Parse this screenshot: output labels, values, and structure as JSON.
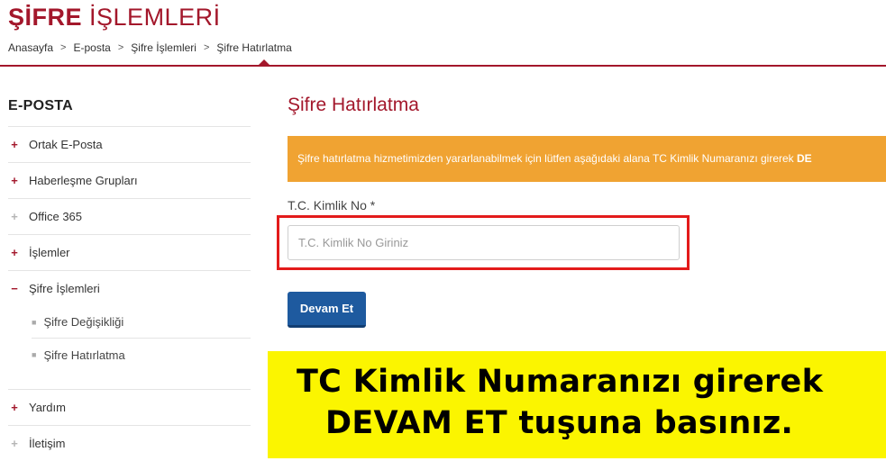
{
  "header": {
    "title_bold": "ŞİFRE",
    "title_light": "İŞLEMLERİ",
    "breadcrumb": [
      "Anasayfa",
      "E-posta",
      "Şifre İşlemleri",
      "Şifre Hatırlatma"
    ],
    "breadcrumb_separator": ">"
  },
  "sidebar": {
    "title": "E-POSTA",
    "items": [
      {
        "label": "Ortak E-Posta",
        "icon": "plus-icon",
        "icon_glyph": "+"
      },
      {
        "label": "Haberleşme Grupları",
        "icon": "plus-icon",
        "icon_glyph": "+"
      },
      {
        "label": "Office 365",
        "icon": "plus-icon",
        "icon_glyph": "+"
      },
      {
        "label": "İşlemler",
        "icon": "plus-icon",
        "icon_glyph": "+"
      },
      {
        "label": "Şifre İşlemleri",
        "icon": "minus-icon",
        "icon_glyph": "−"
      },
      {
        "label": "Yardım",
        "icon": "plus-icon",
        "icon_glyph": "+"
      },
      {
        "label": "İletişim",
        "icon": "plus-icon",
        "icon_glyph": "+"
      }
    ],
    "subitems": [
      {
        "label": "Şifre Değişikliği",
        "bullet": "■"
      },
      {
        "label": "Şifre Hatırlatma",
        "bullet": "■"
      }
    ]
  },
  "main": {
    "heading": "Şifre Hatırlatma",
    "alert_text": "Şifre hatırlatma hizmetimizden yararlanabilmek için lütfen aşağıdaki alana TC Kimlik Numaranızı girerek ",
    "alert_bold": "DE",
    "field_label": "T.C. Kimlik No *",
    "input_placeholder": "T.C. Kimlik No Giriniz",
    "input_value": "",
    "submit_label": "Devam Et"
  },
  "banner": {
    "line1": "TC Kimlik Numaranızı girerek",
    "line2": "DEVAM ET tuşuna basınız."
  },
  "colors": {
    "brand": "#a3172b",
    "alert": "#f0a332",
    "button": "#1e5a9f",
    "highlight": "#e31b1b",
    "banner": "#fbf500",
    "icon_inactive": "#b5b5b5"
  }
}
